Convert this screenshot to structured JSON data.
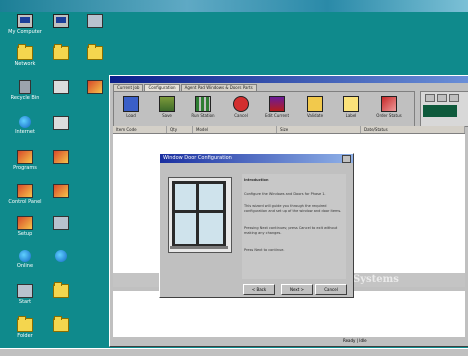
{
  "window": {
    "tabs": [
      {
        "label": "Current Job"
      },
      {
        "label": "Configuration"
      },
      {
        "label": "Agent Pad Windows & Doors Parts"
      }
    ],
    "toolbar": [
      {
        "label": "Load"
      },
      {
        "label": "Save"
      },
      {
        "label": "Run Station"
      },
      {
        "label": "Cancel"
      },
      {
        "label": "Edit Current"
      },
      {
        "label": "Validate"
      },
      {
        "label": "Label"
      },
      {
        "label": "Order Status"
      }
    ],
    "columns": [
      "Item Code",
      "Qty",
      "Model",
      "Size",
      "Date/Status"
    ],
    "brand_text": "Systems",
    "status_text": "Ready | Idle"
  },
  "dialog": {
    "title": "Window Door Configuration",
    "panel_heading": "Introduction",
    "paragraphs": [
      "Configure the Windows and Doors for Phase 1.",
      "This wizard will guide you through the required configuration and set up of the window and door items.",
      "Pressing Next continues; press Cancel to exit without making any changes.",
      "Press Next to continue."
    ],
    "buttons": {
      "back": "< Back",
      "next": "Next >",
      "cancel": "Cancel"
    }
  },
  "desktop_icons": [
    {
      "label": "My Computer",
      "icon": "computer-icon"
    },
    {
      "label": "Network",
      "icon": "folder-icon"
    },
    {
      "label": "Recycle Bin",
      "icon": "trash-icon"
    },
    {
      "label": "Internet",
      "icon": "globe-icon"
    },
    {
      "label": "Programs",
      "icon": "app-icon"
    },
    {
      "label": "Control Panel",
      "icon": "app-icon"
    },
    {
      "label": "Setup",
      "icon": "app-icon"
    },
    {
      "label": "Online",
      "icon": "globe-icon"
    },
    {
      "label": "Start",
      "icon": "network-icon"
    },
    {
      "label": "Folder",
      "icon": "folder-icon"
    }
  ]
}
